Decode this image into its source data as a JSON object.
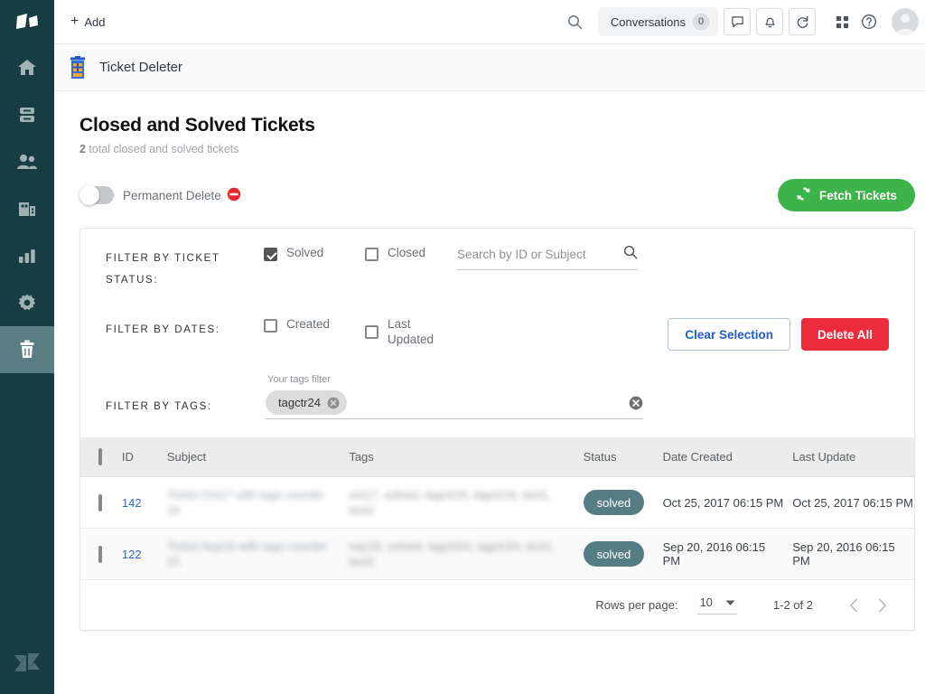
{
  "rail": {
    "logo_icon": "zendesk-logo-icon",
    "items": [
      {
        "name": "home",
        "icon": "home-icon",
        "active": false
      },
      {
        "name": "views",
        "icon": "views-icon",
        "active": false
      },
      {
        "name": "customers",
        "icon": "people-icon",
        "active": false
      },
      {
        "name": "organizations",
        "icon": "building-icon",
        "active": false
      },
      {
        "name": "reporting",
        "icon": "bar-chart-icon",
        "active": false
      },
      {
        "name": "admin",
        "icon": "gear-icon",
        "active": false
      },
      {
        "name": "ticket-deleter",
        "icon": "trash-icon",
        "active": true
      }
    ],
    "bottom_icon": "zendesk-z-icon"
  },
  "topbar": {
    "add_label": "Add",
    "add_icon": "plus-icon",
    "search_icon": "search-icon",
    "conversations_label": "Conversations",
    "conversations_count": "0",
    "chat_icon": "speech-bubble-icon",
    "bell_icon": "bell-icon",
    "refresh_icon": "refresh-icon",
    "apps_icon": "grid-apps-icon",
    "help_icon": "help-circle-icon",
    "avatar_icon": "user-avatar-icon"
  },
  "apphead": {
    "icon": "trash-can-app-icon",
    "title": "Ticket Deleter"
  },
  "page": {
    "title": "Closed and Solved Tickets",
    "subtitle_count": "2",
    "subtitle_text": " total closed and solved tickets",
    "permanent_delete_label": "Permanent Delete",
    "permanent_delete_icon": "no-entry-icon",
    "permanent_delete_on": false,
    "fetch_label": "Fetch Tickets",
    "fetch_icon": "refresh-icon",
    "fetch_color": "#3cb44a"
  },
  "filters": {
    "status_label": "FILTER BY TICKET STATUS:",
    "solved_label": "Solved",
    "solved_checked": true,
    "closed_label": "Closed",
    "closed_checked": false,
    "search_placeholder": "Search by ID or Subject",
    "search_value": "",
    "search_icon": "search-icon",
    "dates_label": "FILTER BY DATES:",
    "created_label": "Created",
    "created_checked": false,
    "last_updated_label": "Last Updated",
    "last_updated_checked": false,
    "clear_label": "Clear Selection",
    "delete_all_label": "Delete All",
    "delete_all_color": "#ec2b3c",
    "tags_label": "FILTER BY TAGS:",
    "tags_field_label": "Your tags filter",
    "tag_chips": [
      {
        "text": "tagctr24",
        "remove_icon": "remove-chip-icon"
      }
    ],
    "tags_clear_icon": "clear-field-icon"
  },
  "table": {
    "columns": [
      "",
      "ID",
      "Subject",
      "Tags",
      "Status",
      "Date Created",
      "Last Update"
    ],
    "select_all_checked": false,
    "rows": [
      {
        "selected": false,
        "id": "142",
        "subject": "Ticket Oct17 with tags counter 24",
        "tags": "oct17, solved, tagctr24, tagctr24, test1, test2",
        "status": "solved",
        "date_created": "Oct 25, 2017 06:15 PM",
        "last_update": "Oct 25, 2017 06:15 PM"
      },
      {
        "selected": false,
        "id": "122",
        "subject": "Ticket Sep16 with tags counter 24",
        "tags": "sep16, solved, tagctr24, tagctr24, test1, test2",
        "status": "solved",
        "date_created": "Sep 20, 2016 06:15 PM",
        "last_update": "Sep 20, 2016 06:15 PM"
      }
    ],
    "status_badge_color": "#567d86"
  },
  "pagination": {
    "rows_per_page_label": "Rows per page:",
    "rows_per_page_value": "10",
    "dropdown_icon": "chevron-down-icon",
    "range_label": "1-2 of 2",
    "prev_icon": "chevron-left-icon",
    "next_icon": "chevron-right-icon"
  }
}
